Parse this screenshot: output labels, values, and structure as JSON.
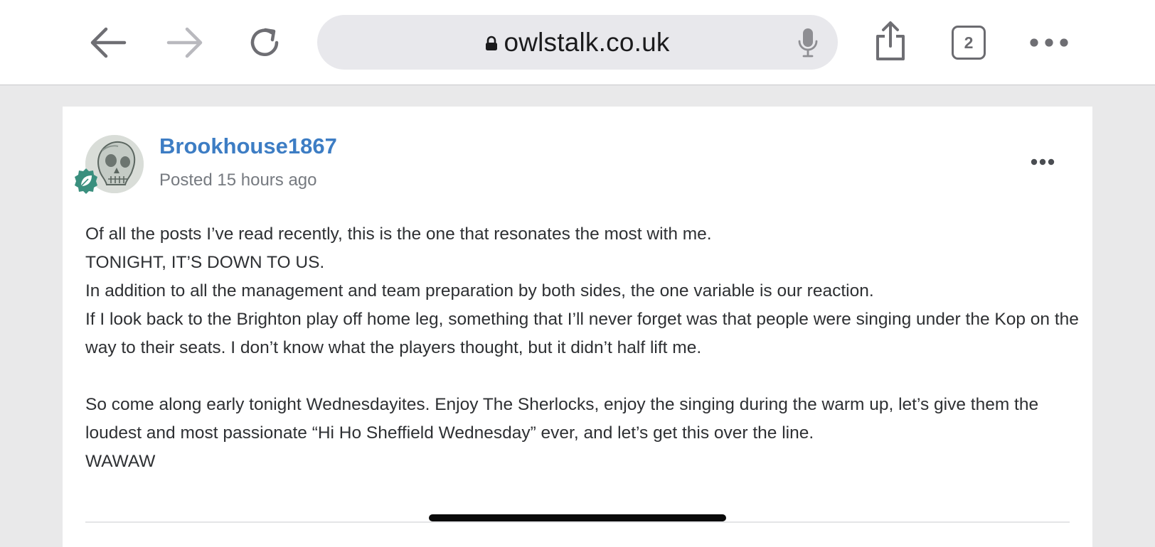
{
  "browser": {
    "url": "owlstalk.co.uk",
    "tab_count": "2",
    "icons": {
      "back": "back-arrow-icon",
      "forward": "forward-arrow-icon",
      "reload": "reload-icon",
      "lock": "lock-icon",
      "mic": "microphone-icon",
      "share": "share-icon",
      "more": "more-dots-icon"
    }
  },
  "post": {
    "author": "Brookhouse1867",
    "posted": "Posted 15 hours ago",
    "paragraphs": [
      "Of all the posts I’ve read recently, this is the one that resonates the most with me.",
      "TONIGHT, IT’S DOWN TO US.",
      "In addition to all the management and team preparation by both sides, the one variable is our reaction.",
      "If I look back to the Brighton play off home leg, something that I’ll never forget was that people were singing under the Kop on the way to their seats. I don’t know what the players thought, but it didn’t half lift me.",
      "",
      "So come along early tonight Wednesdayites. Enjoy The Sherlocks, enjoy the singing during the warm up, let’s give them the loudest and most passionate “Hi Ho Sheffield Wednesday” ever, and let’s get this over the line.",
      "WAWAW"
    ]
  },
  "colors": {
    "author_link": "#3d7dc4",
    "rank_badge": "#3a8f7e",
    "page_background": "#e9e9ea"
  }
}
